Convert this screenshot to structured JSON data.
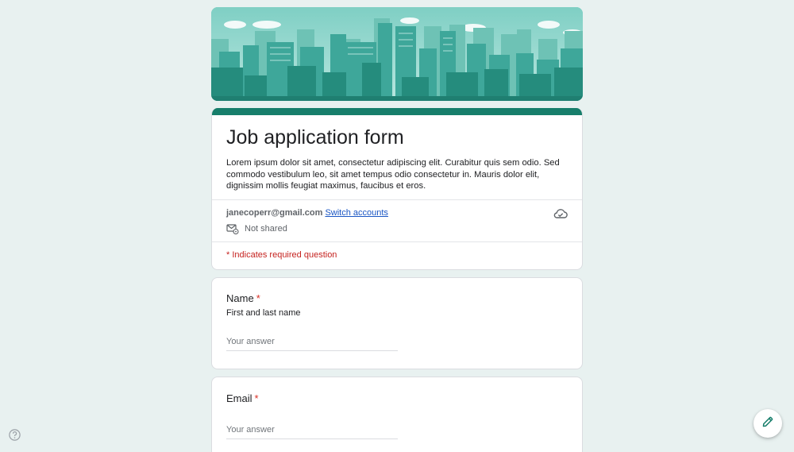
{
  "form": {
    "title": "Job application form",
    "description": "Lorem ipsum dolor sit amet, consectetur adipiscing elit. Curabitur quis sem odio. Sed commodo vestibulum leo, sit amet tempus odio consectetur in. Mauris dolor elit, dignissim mollis feugiat maximus, faucibus et eros.",
    "accent_color": "#177e6b"
  },
  "account": {
    "email": "janecoperr@gmail.com",
    "switch_label": "Switch accounts",
    "shared_status": "Not shared"
  },
  "required_note": "* Indicates required question",
  "questions": [
    {
      "title": "Name",
      "required_mark": "*",
      "help": "First and last name",
      "placeholder": "Your answer"
    },
    {
      "title": "Email",
      "required_mark": "*",
      "placeholder": "Your answer"
    }
  ],
  "icons": {
    "banner": "city-skyline-banner",
    "mail": "mail-settings-icon",
    "cloud": "cloud-saved-icon",
    "help": "help-icon",
    "edit": "pencil-icon"
  }
}
